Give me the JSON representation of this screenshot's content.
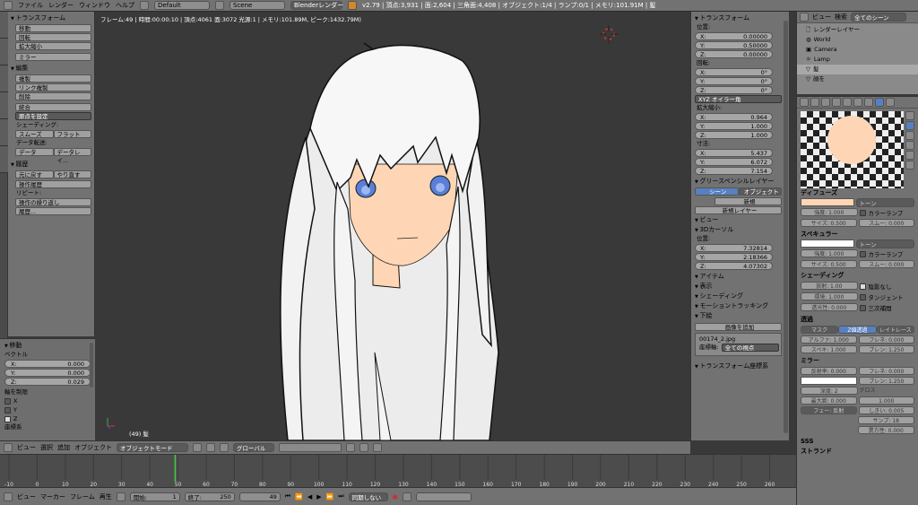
{
  "topbar": {
    "menus": [
      "ファイル",
      "レンダー",
      "ウィンドウ",
      "ヘルプ"
    ],
    "layout": "Default",
    "scene": "Scene",
    "engine": "Blenderレンダー",
    "stats": "v2.79 | 頂点:3,931 | 面:2,604 | 三角面:4,408 | オブジェクト:1/4 | ランプ:0/1 | メモリ:101.91M | 髪"
  },
  "toolshelf": {
    "transform_header": "トランスフォーム",
    "transform_buttons": [
      "移動",
      "回転",
      "拡大縮小",
      "ミラー"
    ],
    "edit_header": "編集",
    "edit_buttons": [
      "複製",
      "リンク複製",
      "削除",
      "統合",
      "原点を設定"
    ],
    "shading_label": "シェーディング:",
    "smooth": "スムーズ",
    "flat": "フラット",
    "data_transfer_label": "データ転送:",
    "data": "データ",
    "data_layout": "データレイ...",
    "history_header": "履歴",
    "undo": "元に戻す",
    "redo": "やり直す",
    "undo_history": "操作履歴",
    "repeat_label": "リピート:",
    "repeat_last": "操作の繰り返し",
    "history": "履歴..."
  },
  "operator": {
    "header": "移動",
    "vector_label": "ベクトル",
    "x": {
      "label": "X:",
      "value": "0.000"
    },
    "y": {
      "label": "Y:",
      "value": "0.000"
    },
    "z": {
      "label": "Z:",
      "value": "0.029"
    },
    "constraint_label": "軸を制限",
    "axes": [
      "X",
      "Y",
      "Z"
    ],
    "orientation_label": "座標系"
  },
  "viewport": {
    "info": "フレーム:49 | 時間:00:00:10 | 頂点:4061 面:3072 光源:1 | メモリ:101.89M, ピーク:1432.79M)",
    "object_label": "(49) 髪"
  },
  "vphdr": {
    "items": [
      "ビュー",
      "選択",
      "追加",
      "オブジェクト"
    ],
    "mode": "オブジェクトモード",
    "orientation": "グローバル"
  },
  "npanel": {
    "transform": "トランスフォーム",
    "location": "位置:",
    "loc": [
      "0.00000",
      "0.50000",
      "0.00000"
    ],
    "rotation": "回転:",
    "rot": [
      "0°",
      "0°",
      "0°"
    ],
    "rot_mode": "XYZ オイラー角",
    "scale": "拡大縮小:",
    "scl": [
      "0.964",
      "1.000",
      "1.000"
    ],
    "dimensions": "寸法:",
    "dim": [
      "5.437",
      "6.072",
      "7.154"
    ],
    "gp_layer": "グリースペンシルレイヤー",
    "scene_tab": "シーン",
    "object_tab": "オブジェクト",
    "new": "新規",
    "new_layer": "新規レイヤー",
    "view": "ビュー",
    "cursor": "3Dカーソル",
    "cursor_loc": "位置:",
    "cur": [
      "7.32814",
      "2.18366",
      "4.07302"
    ],
    "item": "アイテム",
    "display": "表示",
    "shading": "シェーディング",
    "motion": "モーショントラッキング",
    "background": "下絵",
    "add_image": "画像を追加",
    "image_name": "00174_2.jpg",
    "axis_label": "座標軸:",
    "axis_value": "全ての視点",
    "transform_orient": "トランスフォーム座標系",
    "axes": [
      "X:",
      "Y:",
      "Z:"
    ]
  },
  "timeline": {
    "ticks": [
      "-10",
      "0",
      "10",
      "20",
      "30",
      "40",
      "50",
      "60",
      "70",
      "80",
      "90",
      "100",
      "110",
      "120",
      "130",
      "140",
      "150",
      "160",
      "170",
      "180",
      "190",
      "200",
      "210",
      "220",
      "230",
      "240",
      "250",
      "260"
    ],
    "items": [
      "ビュー",
      "マーカー",
      "フレーム",
      "再生"
    ],
    "start_label": "開始:",
    "start": "1",
    "end_label": "終了:",
    "end": "250",
    "current": "49",
    "sync": "同期しない"
  },
  "outliner": {
    "items": [
      "ビュー",
      "検索"
    ],
    "filter": "全てのシーン",
    "rows": [
      "レンダーレイヤー",
      "World",
      "Camera",
      "Lamp",
      "髪",
      "顔を"
    ]
  },
  "props": {
    "diffuse": "ディフューズ",
    "toon": "トーン",
    "intensity": "強度: 1.000",
    "ramp": "カラーランプ",
    "size": "サイズ: 0.500",
    "smooth": "スムー: 0.000",
    "specular": "スペキュラー",
    "intensity2": "強度: 1.000",
    "size2": "サイズ: 0.500",
    "smooth2": "スムー: 0.000",
    "shading": "シェーディング",
    "emit": "放射: 1.00",
    "shadeless": "陰影なし",
    "ambient": "環境: 1.000",
    "tangent": "タンジェント",
    "translucency": "透光性: 0.000",
    "cubic": "三次補間",
    "transparency": "透過",
    "mask": "マスク",
    "ztrans": "Z値透過",
    "raytrace": "レイトレース",
    "alpha": "アルファ: 1.000",
    "fresnel": "フレネ: 0.000",
    "spec": "スペキ: 1.000",
    "blend": "ブレン: 1.250",
    "mirror": "ミラー",
    "reflect": "反射率: 0.000",
    "fresnel2": "フレネ: 0.000",
    "blend2": "ブレン: 1.250",
    "depth": "深度: 2",
    "max_dist": "最大距: 0.000",
    "fade": "フェー: 反射",
    "gloss": "グロス",
    "amount": "1.000",
    "thresh": "しきい: 0.005",
    "samples": "サンプ: 18",
    "aniso": "異方性: 0.000",
    "sss": "SSS",
    "strand": "ストランド",
    "colors": {
      "diffuse": "#ffd6b5",
      "spec": "#ffffff",
      "mirror": "#ffffff"
    }
  }
}
